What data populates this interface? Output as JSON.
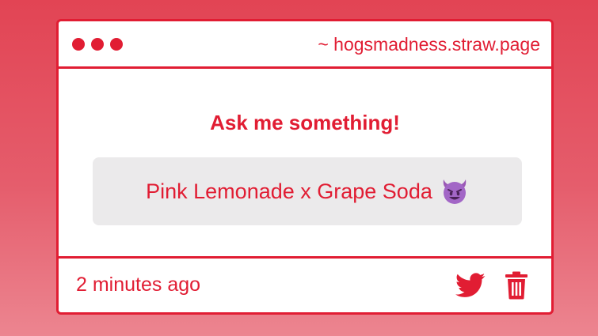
{
  "window": {
    "url": "~ hogsmadness.straw.page"
  },
  "main": {
    "heading": "Ask me something!",
    "answer_text": "Pink Lemonade x Grape Soda",
    "answer_emoji": "smiling-face-with-horns-icon"
  },
  "footer": {
    "timestamp": "2 minutes ago",
    "share_icon": "twitter-icon",
    "delete_icon": "trash-icon"
  },
  "colors": {
    "accent": "#e11d33",
    "card_background": "#ffffff",
    "answer_background": "#ebeaeb",
    "page_gradient_top": "#e24454",
    "page_gradient_bottom": "#ec8590"
  }
}
